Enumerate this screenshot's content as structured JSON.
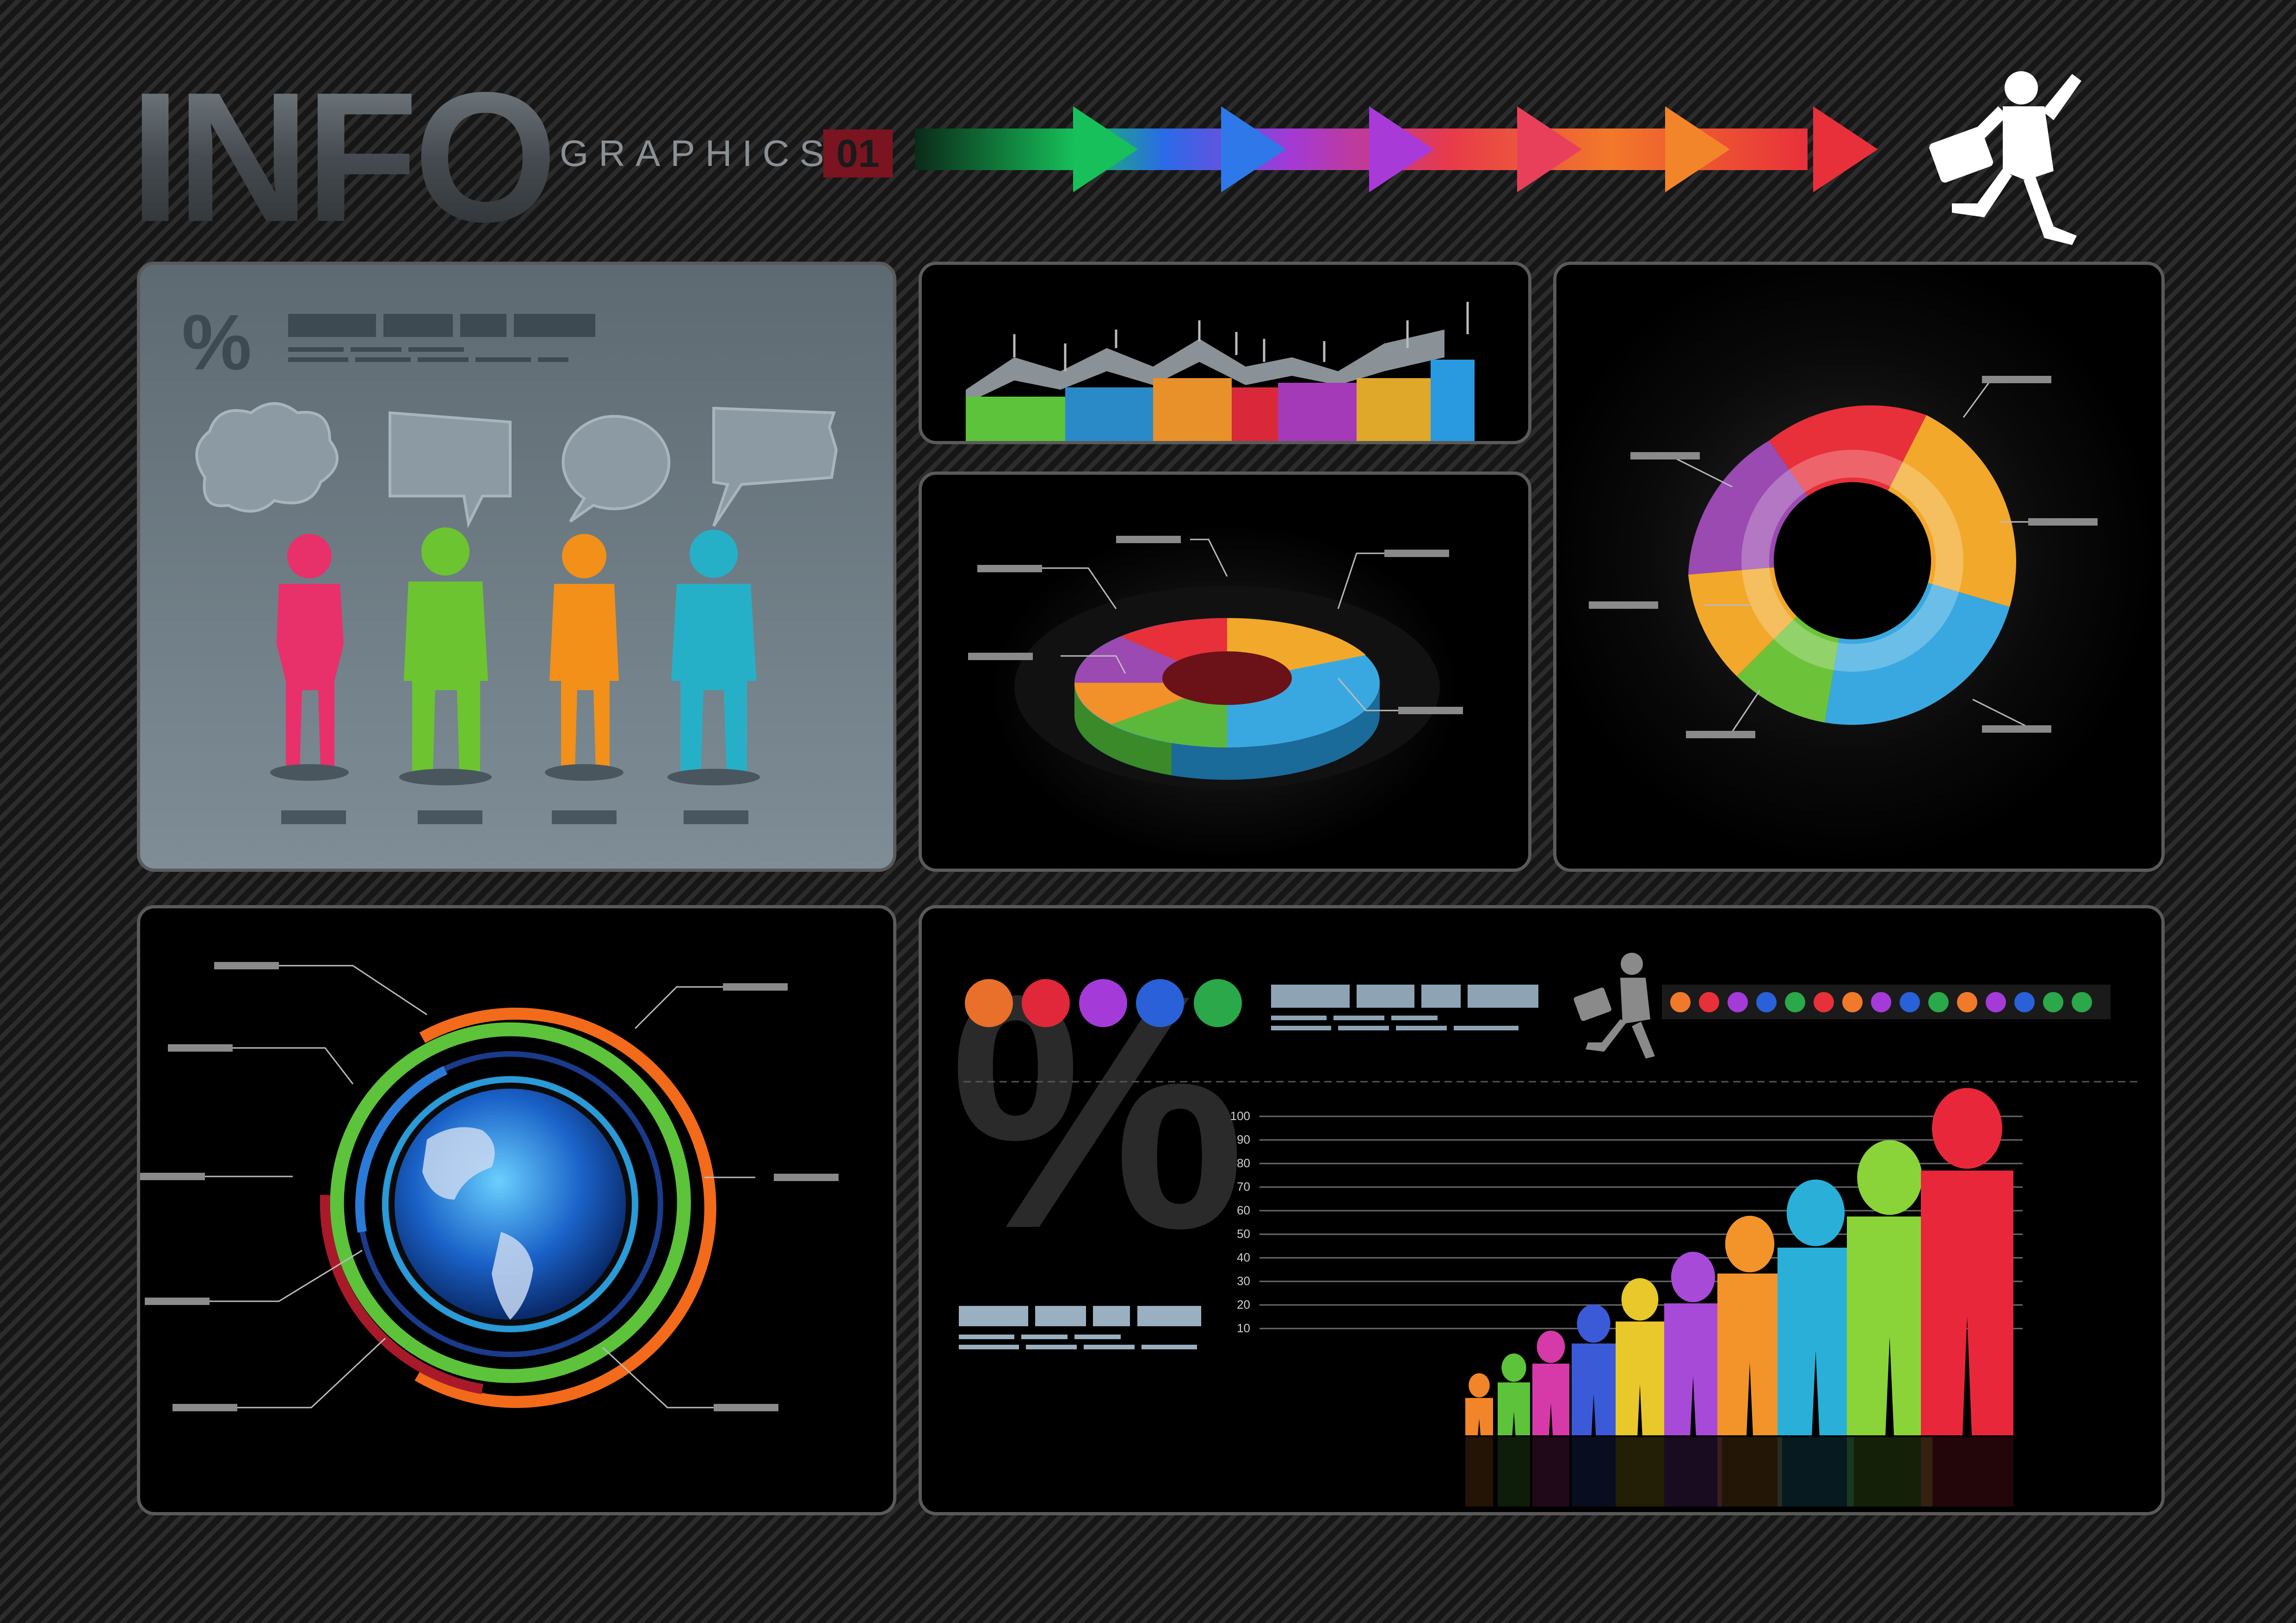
{
  "header": {
    "title_main": "INFO",
    "title_sub": "GRAPHICS",
    "title_number": "01",
    "arrow_colors": [
      "#17c05a",
      "#2a6ae8",
      "#a23ad6",
      "#e83a4a",
      "#f2782a",
      "#e8303a"
    ],
    "runner_icon": "businessman-running-icon"
  },
  "panels": {
    "people_speech": {
      "percent_symbol": "%",
      "speech_icons": [
        "cloud-bubble-icon",
        "rect-bubble-icon",
        "round-bubble-icon",
        "flag-bubble-icon"
      ],
      "figure_colors": [
        "#e8306a",
        "#6cc430",
        "#f2901a",
        "#26b0c8"
      ]
    },
    "area_chart": {
      "colors": [
        "#5cc33a",
        "#2a8ac8",
        "#e8902a",
        "#d8283a",
        "#a43ab8",
        "#e0a82a",
        "#2a9ae0"
      ]
    },
    "donut_3d": {
      "colors": [
        "#e8303a",
        "#f2a82a",
        "#3aa8e0",
        "#5cb83a",
        "#f2902a",
        "#9a4ab0"
      ]
    },
    "ring_chart": {
      "colors": [
        "#e8303a",
        "#f2a82a",
        "#3aa8e0",
        "#6cc33a",
        "#f2a82a",
        "#9a4ab0"
      ]
    },
    "globe_rings": {
      "ring_colors": [
        "#f26a1a",
        "#5cc33a",
        "#2a7ad8",
        "#a81a2a"
      ],
      "globe_icon": "globe-icon"
    },
    "people_bars": {
      "percent_symbol": "%",
      "balls": [
        "#e8702a",
        "#e0283a",
        "#a43ad8",
        "#2a60d8",
        "#2aa84a"
      ],
      "small_dots": [
        "#f07a2a",
        "#e8303a",
        "#a43ad8",
        "#2a60d8",
        "#2aa84a",
        "#e8303a",
        "#f07a2a",
        "#a43ad8",
        "#2a60d8",
        "#2aa84a",
        "#f07a2a",
        "#a43ad8",
        "#2a60d8",
        "#2aa84a",
        "#2aa84a"
      ],
      "runner_icon": "businessman-running-icon"
    }
  },
  "chart_data": {
    "type": "bar",
    "ytick_labels": [
      "100",
      "90",
      "80",
      "70",
      "60",
      "50",
      "40",
      "30",
      "20",
      "10"
    ],
    "ylim": [
      0,
      100
    ],
    "values": [
      10,
      13,
      19,
      26,
      34,
      42,
      50,
      61,
      72,
      84,
      100
    ],
    "colors": [
      "#f2842a",
      "#5cc33a",
      "#d63aa8",
      "#3a5ad8",
      "#e8c82a",
      "#a84ad8",
      "#f2942a",
      "#2ab0d8",
      "#8ad43a",
      "#e8283a",
      "#e8283a"
    ]
  }
}
